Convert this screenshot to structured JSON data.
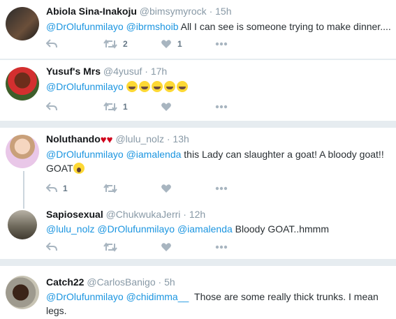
{
  "tweets": [
    {
      "name": "Abiola Sina-Inakoju",
      "handle": "@bimsymyrock",
      "time": "15h",
      "mentions": [
        "@DrOlufunmilayo",
        "@ibrmshoib"
      ],
      "text": "All I can see is someone trying to make dinner....",
      "retweets": "2",
      "likes": "1"
    },
    {
      "name": "Yusuf's Mrs",
      "handle": "@4yusuf",
      "time": "17h",
      "mentions": [
        "@DrOlufunmilayo"
      ],
      "text": "",
      "retweets": "1",
      "likes": ""
    },
    {
      "name": "Noluthando",
      "handle": "@lulu_nolz",
      "time": "13h",
      "mentions": [
        "@DrOlufunmilayo",
        "@iamalenda"
      ],
      "text": "this Lady can slaughter a goat! A bloody goat!!",
      "text2": "GOAT",
      "replies": "1"
    },
    {
      "name": "Sapiosexual",
      "handle": "@ChukwukaJerri",
      "time": "12h",
      "mentions": [
        "@lulu_nolz",
        "@DrOlufunmilayo",
        "@iamalenda"
      ],
      "text": "Bloody GOAT..hmmm"
    },
    {
      "name": "Catch22",
      "handle": "@CarlosBanigo",
      "time": "5h",
      "mentions": [
        "@DrOlufunmilayo",
        "@chidimma__"
      ],
      "text": "Those are some really thick trunks. I mean",
      "text2": "legs."
    }
  ],
  "separator": "·",
  "icons": {
    "reply": "reply-icon",
    "retweet": "retweet-icon",
    "like": "heart-icon",
    "more": "more-icon"
  },
  "colors": {
    "mention": "#1b95e0",
    "icon": "#a8b5c0",
    "background": "#e6ecf0"
  }
}
